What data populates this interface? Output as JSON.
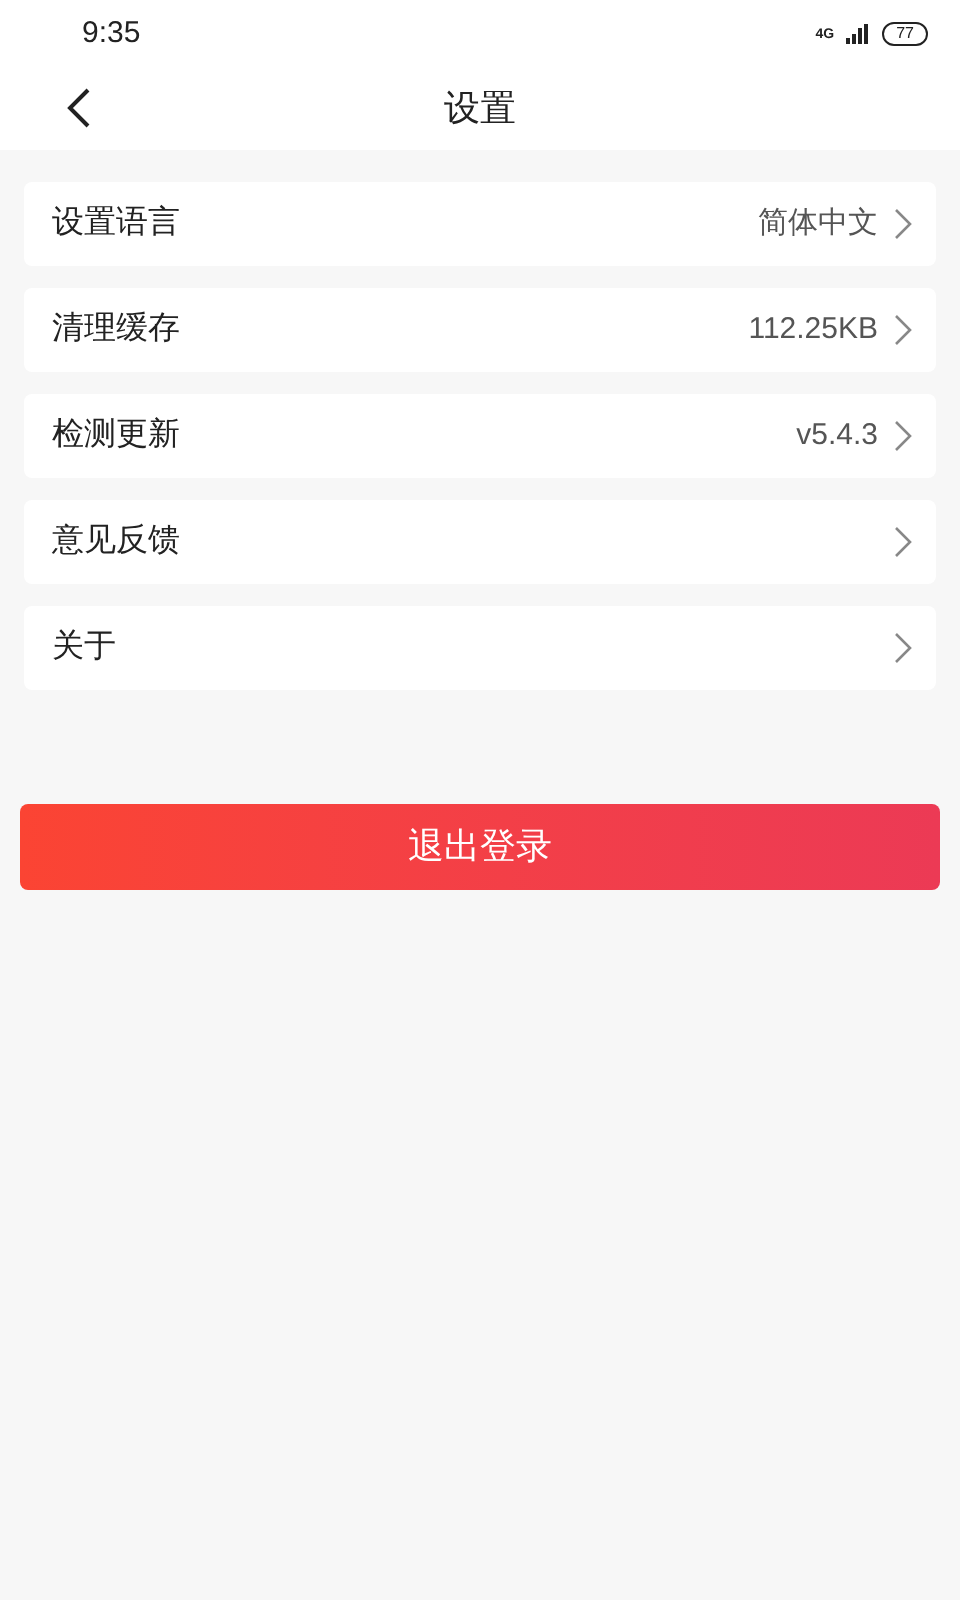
{
  "status_bar": {
    "time": "9:35",
    "network": "4G",
    "battery": "77"
  },
  "header": {
    "title": "设置"
  },
  "settings": [
    {
      "label": "设置语言",
      "value": "简体中文"
    },
    {
      "label": "清理缓存",
      "value": "112.25KB"
    },
    {
      "label": "检测更新",
      "value": "v5.4.3"
    },
    {
      "label": "意见反馈"
    },
    {
      "label": "关于"
    }
  ],
  "logout_button": "退出登录"
}
